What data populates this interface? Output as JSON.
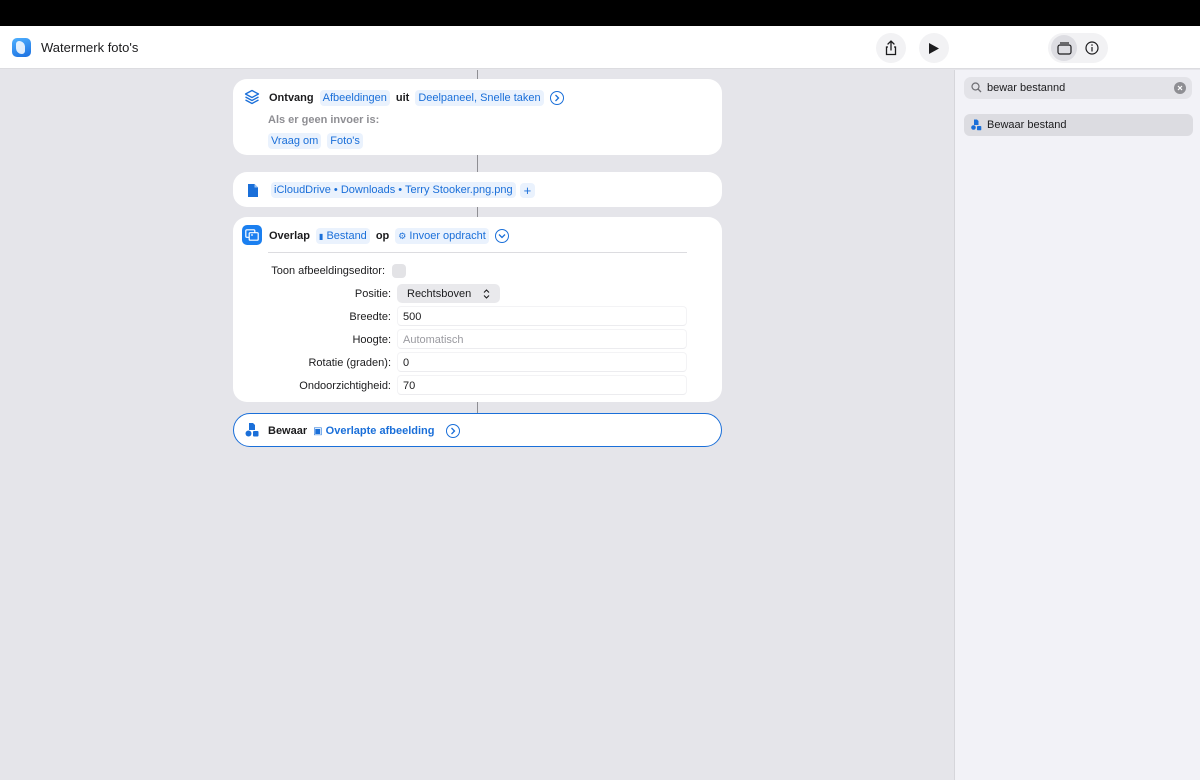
{
  "app": {
    "title": "Watermerk foto's"
  },
  "actions": {
    "receive": {
      "verb": "Ontvang",
      "input_type": "Afbeeldingen",
      "from_word": "uit",
      "sources": "Deelpaneel, Snelle taken",
      "no_input_label": "Als er geen invoer is:",
      "fallback_action": "Vraag om",
      "fallback_target": "Foto's"
    },
    "file": {
      "path": "iCloudDrive • Downloads • Terry Stooker.png.png",
      "add_symbol": "+"
    },
    "overlay": {
      "verb": "Overlap",
      "param1": "Bestand",
      "on_word": "op",
      "param2": "Invoer opdracht",
      "fields": {
        "editor_label": "Toon afbeeldingseditor:",
        "position_label": "Positie:",
        "position_value": "Rechtsboven",
        "width_label": "Breedte:",
        "width_value": "500",
        "height_label": "Hoogte:",
        "height_placeholder": "Automatisch",
        "rotation_label": "Rotatie (graden):",
        "rotation_value": "0",
        "opacity_label": "Ondoorzichtigheid:",
        "opacity_value": "70"
      }
    },
    "save": {
      "verb": "Bewaar",
      "param": "Overlapte afbeelding"
    }
  },
  "sidebar": {
    "search_value": "bewar bestannd",
    "results": [
      {
        "label": "Bewaar bestand"
      }
    ]
  },
  "colors": {
    "accent": "#1a6fd9",
    "token_bg": "#eaf2fd",
    "canvas_bg": "#e5e5ea"
  }
}
